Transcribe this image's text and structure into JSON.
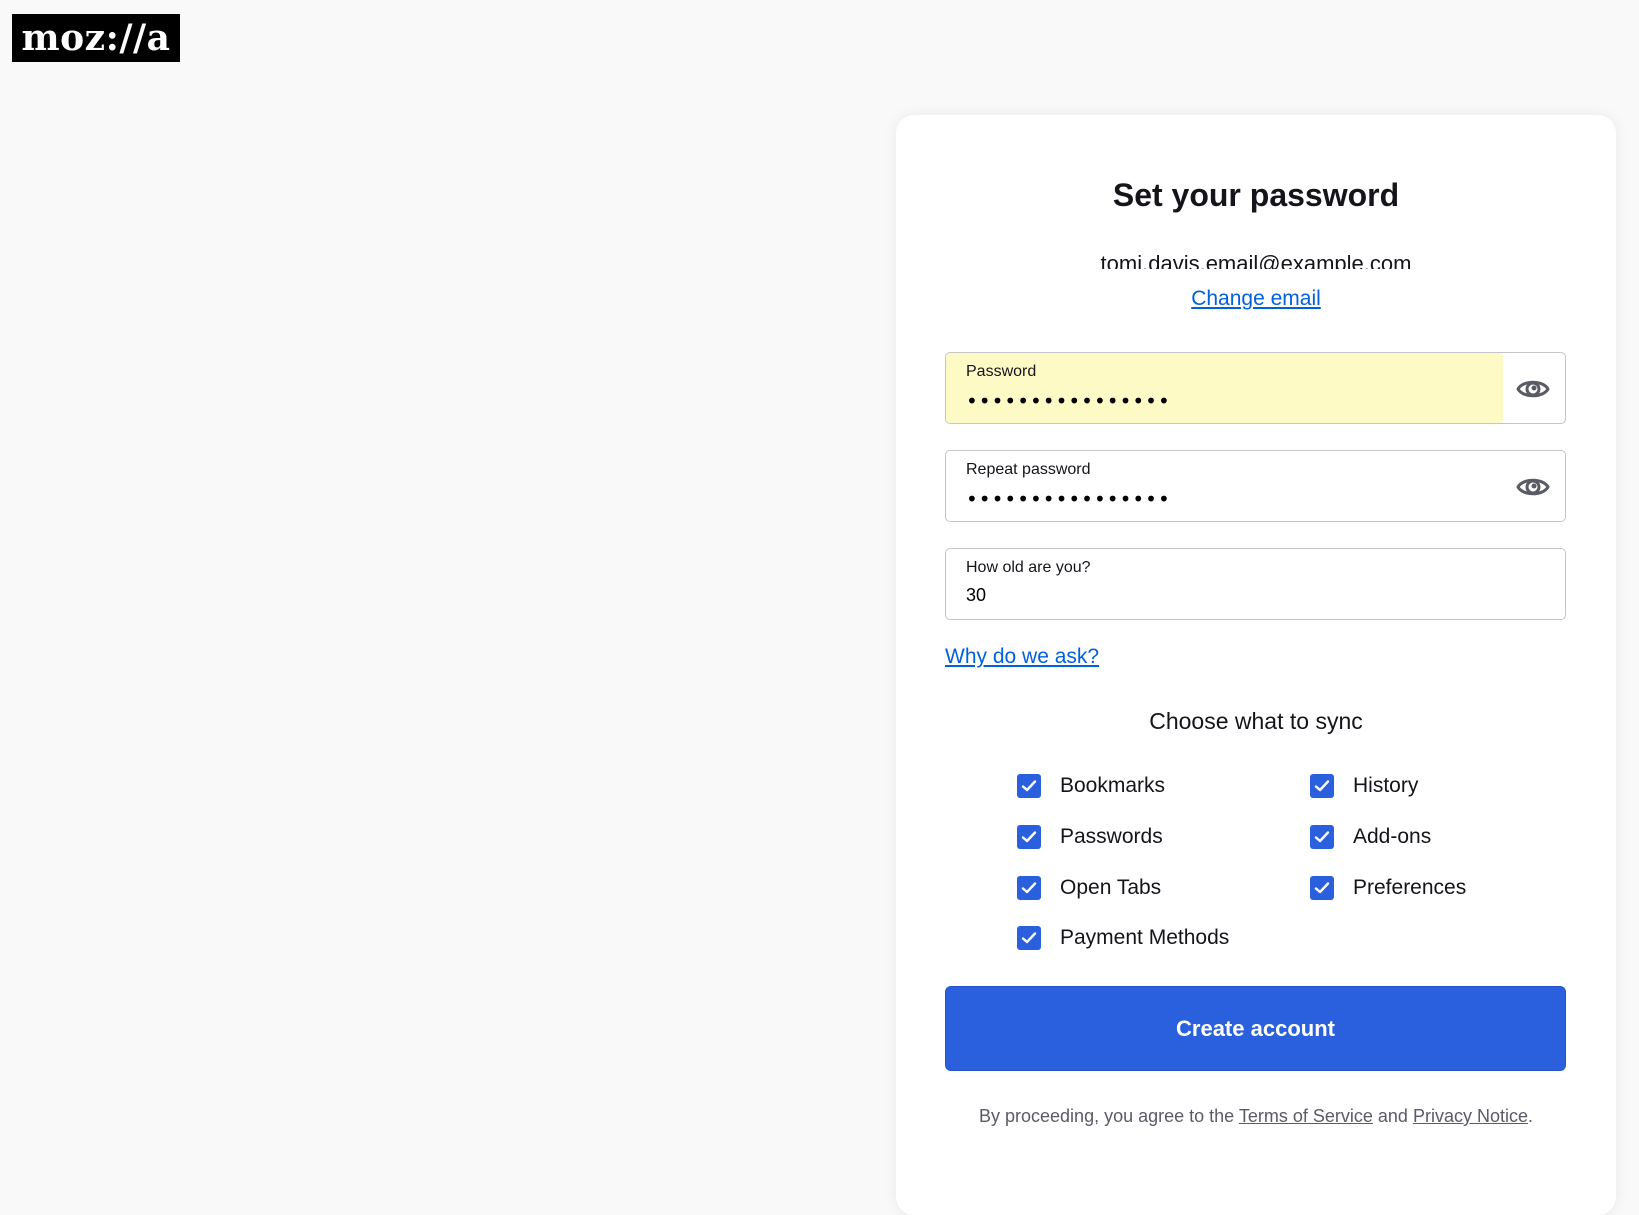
{
  "logo": {
    "text": "moz://a"
  },
  "card": {
    "title": "Set your password",
    "email": "tomi.davis.email@example.com",
    "change_email_label": "Change email"
  },
  "fields": {
    "password": {
      "label": "Password",
      "value": "••••••••••••••••",
      "autofilled": true
    },
    "repeat_password": {
      "label": "Repeat password",
      "value": "••••••••••••••••"
    },
    "age": {
      "label": "How old are you?",
      "value": "30"
    }
  },
  "why_link": "Why do we ask?",
  "sync": {
    "title": "Choose what to sync",
    "items": [
      {
        "label": "Bookmarks",
        "checked": true
      },
      {
        "label": "History",
        "checked": true
      },
      {
        "label": "Passwords",
        "checked": true
      },
      {
        "label": "Add-ons",
        "checked": true
      },
      {
        "label": "Open Tabs",
        "checked": true
      },
      {
        "label": "Preferences",
        "checked": true
      },
      {
        "label": "Payment Methods",
        "checked": true
      }
    ]
  },
  "create_button": "Create account",
  "footer": {
    "prefix": "By proceeding, you agree to the ",
    "terms": "Terms of Service",
    "and": " and ",
    "privacy": "Privacy Notice",
    "suffix": "."
  },
  "colors": {
    "accent": "#2a5fde",
    "link": "#0060df",
    "autofill": "#fefac6",
    "background": "#f9f9fa"
  }
}
